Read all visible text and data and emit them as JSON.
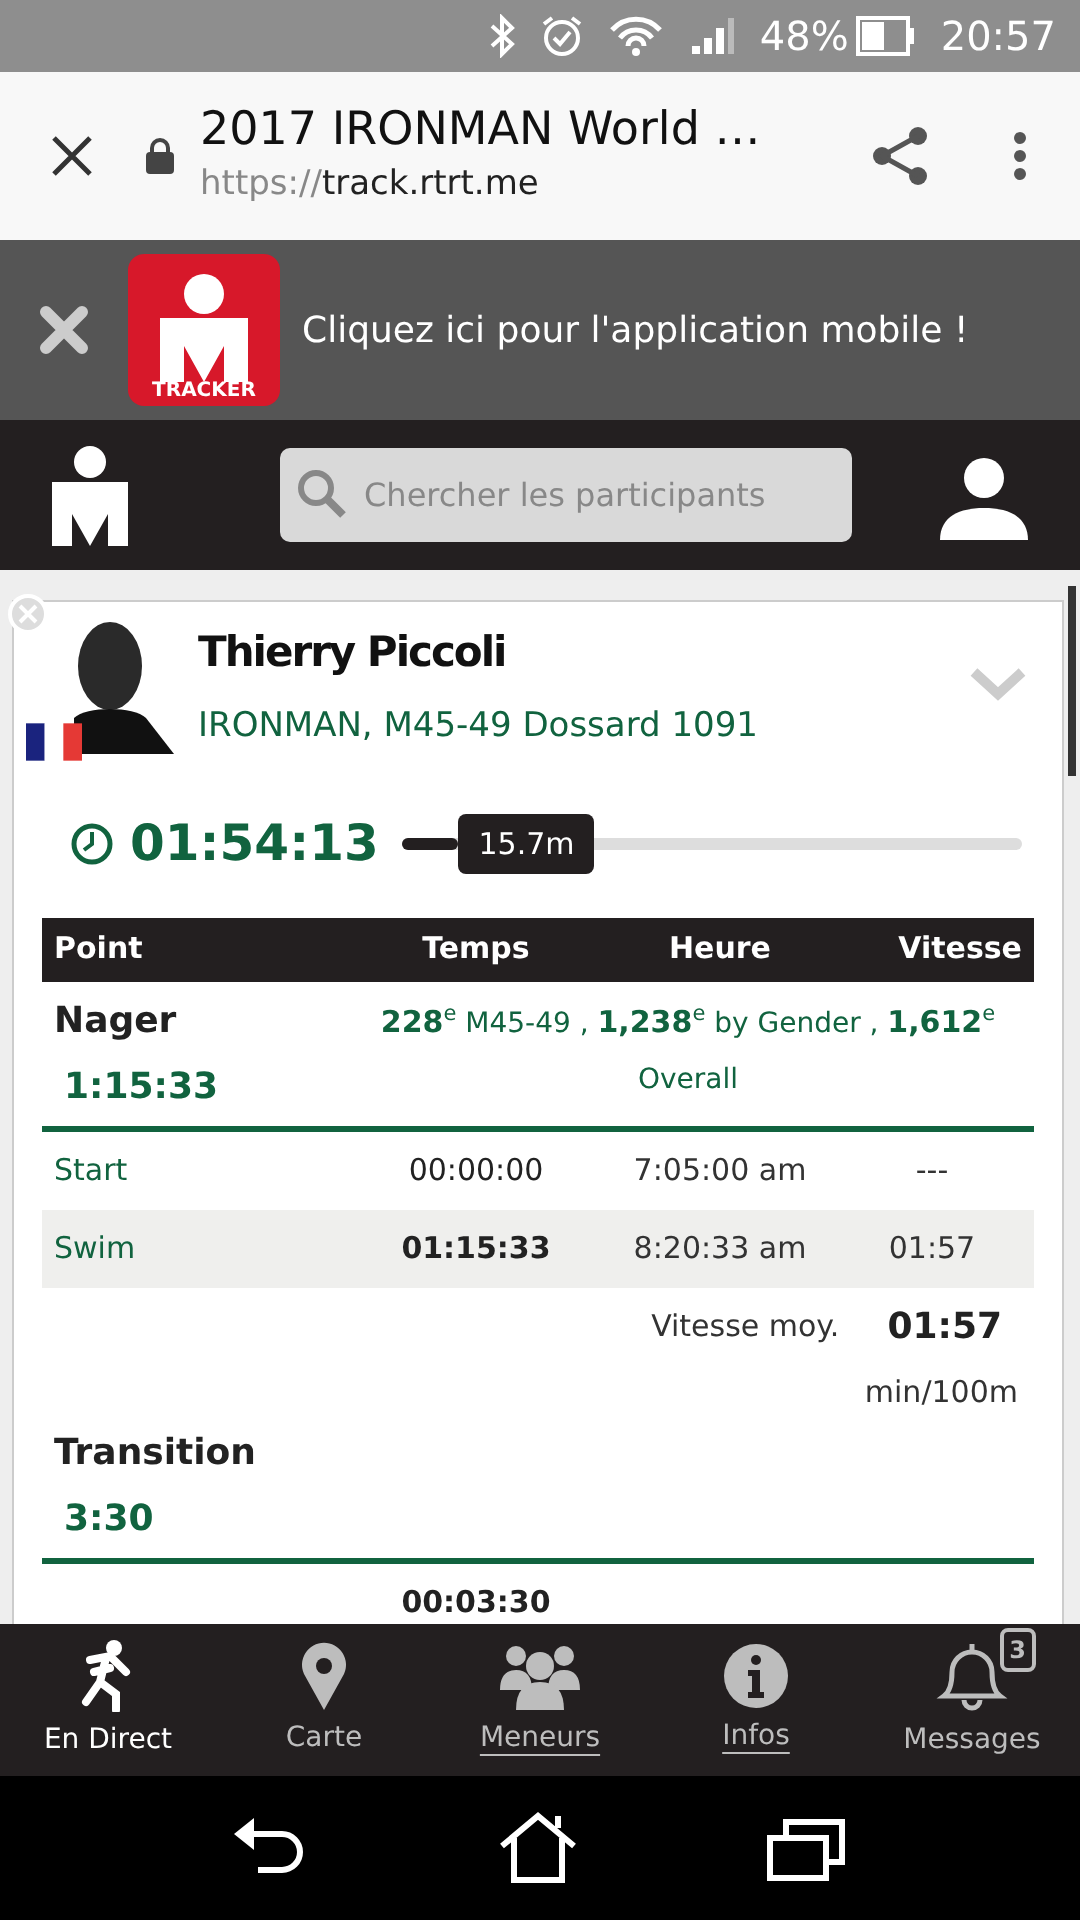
{
  "status_bar": {
    "battery": "48%",
    "time": "20:57"
  },
  "browser": {
    "title": "2017 IRONMAN World …",
    "url_scheme": "https://",
    "url_host": "track.rtrt.me"
  },
  "banner": {
    "logo_text": "TRACKER",
    "message": "Cliquez ici pour l'application mobile !"
  },
  "search": {
    "placeholder": "Chercher les participants"
  },
  "athlete": {
    "name": "Thierry Piccoli",
    "details": "IRONMAN, M45-49 Dossard 1091",
    "elapsed": "01:54:13",
    "progress": {
      "level": 0.09,
      "reading": "15.7m"
    }
  },
  "table": {
    "columns": [
      "Point",
      "Temps",
      "Heure",
      "Vitesse"
    ],
    "sections": [
      {
        "title": "Nager",
        "duration": "1:15:33",
        "ranks": "**228**$^{e}$ M45-49 ,  **1,238**$^{e}$ by Gender ,  **1,612**$^{e}$ Overall",
        "rows": [
          {
            "point": "Start",
            "time": "00:00:00",
            "clock": "7:05:00 am",
            "speed": "---",
            "highlighted": false,
            "bold_time": false
          },
          {
            "point": "Swim",
            "time": "01:15:33",
            "clock": "8:20:33 am",
            "speed": "01:57",
            "highlighted": true,
            "bold_time": true
          }
        ],
        "avg_label": "Vitesse moy.",
        "avg_value": "01:57",
        "avg_unit": "min/100m"
      },
      {
        "title": "Transition",
        "duration": "3:30",
        "rows": [
          {
            "time": "00:03:30",
            "highlighted": false,
            "bold_time": true
          }
        ]
      }
    ]
  },
  "bottom_nav": [
    {
      "label": "En Direct",
      "selected": true,
      "underlined": false
    },
    {
      "label": "Carte",
      "selected": false,
      "underlined": false
    },
    {
      "label": "Meneurs",
      "selected": false,
      "underlined": true
    },
    {
      "label": "Infos",
      "selected": false,
      "underlined": true
    },
    {
      "label": "Messages",
      "selected": false,
      "underlined": false,
      "badge": "3"
    }
  ]
}
